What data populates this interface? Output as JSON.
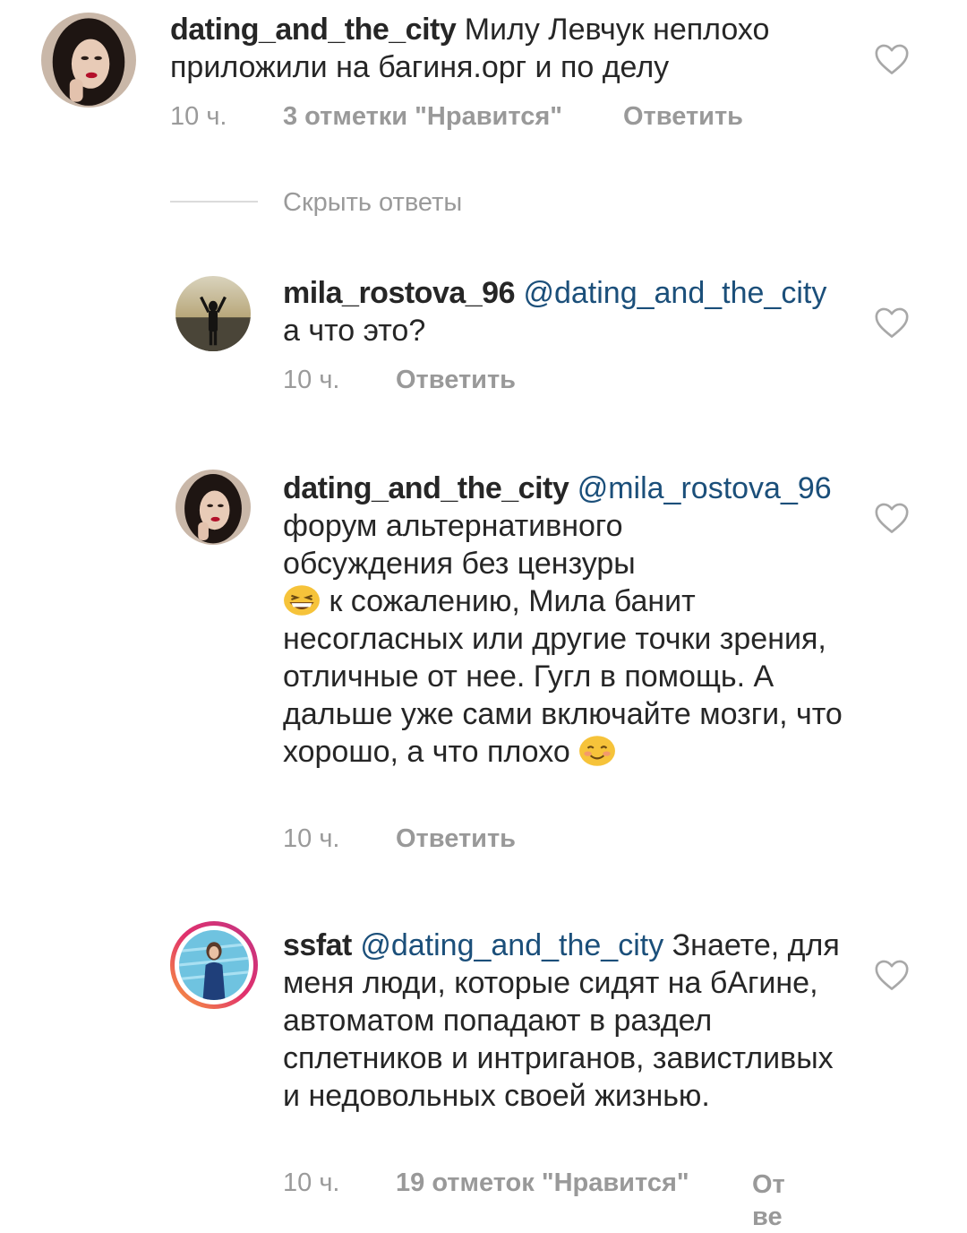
{
  "comments": [
    {
      "username": "dating_and_the_city",
      "text": " Милу Левчук неплохо приложили на багиня.орг и по делу",
      "time": "10 ч.",
      "likes": "3 отметки \"Нравится\"",
      "reply": "Ответить"
    },
    {
      "username": "mila_rostova_96",
      "mention": "@dating_and_the_city",
      "text": "а что это?",
      "time": "10 ч.",
      "reply": "Ответить"
    },
    {
      "username": "dating_and_the_city",
      "mention": "@mila_rostova_96",
      "text_1": "форум альтернативного обсуждения без цензуры",
      "text_2": " к сожалению, Мила банит несогласных или другие точки зрения, отличные от нее. Гугл в помощь. А дальше уже сами включайте мозги, что хорошо, а что плохо ",
      "time": "10 ч.",
      "reply": "Ответить"
    },
    {
      "username": "ssfat",
      "mention": "@dating_and_the_city",
      "text": " Знаете, для меня люди, которые сидят на бАгине, автоматом попадают в раздел сплетников и интриганов, завистливых и недовольных своей жизнью.",
      "time": "10 ч.",
      "likes": "19 отметок \"Нравится\"",
      "reply_line1": "От",
      "reply_line2": "ве"
    }
  ],
  "thread": {
    "hide_replies": "Скрыть ответы"
  },
  "icons": {
    "like": "heart-outline-icon",
    "emoji_1": "grinning-squinting-face-emoji",
    "emoji_2": "smiling-face-emoji"
  },
  "colors": {
    "mention": "#1b4f7a",
    "meta": "#9a9a9a",
    "text": "#262626",
    "story_ring": "#d6249f"
  }
}
